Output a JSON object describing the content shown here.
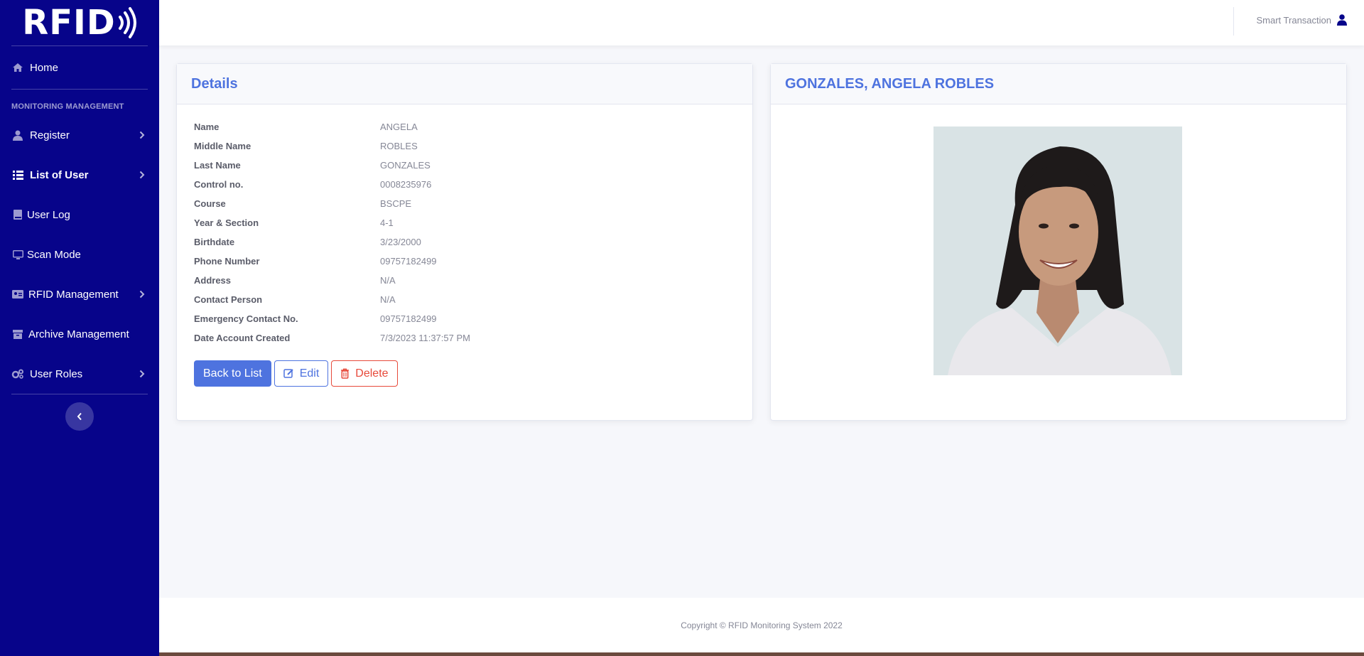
{
  "sidebar": {
    "brand": "RFID",
    "items": [
      {
        "label": "Home"
      },
      {
        "label": "Register"
      },
      {
        "label": "List of User"
      },
      {
        "label": "User Log"
      },
      {
        "label": "Scan Mode"
      },
      {
        "label": "RFID Management"
      },
      {
        "label": "Archive Management"
      },
      {
        "label": "User Roles"
      }
    ],
    "section_heading": "MONITORING MANAGEMENT"
  },
  "topbar": {
    "user_name": "Smart Transaction"
  },
  "details": {
    "title": "Details",
    "fields": [
      {
        "label": "Name",
        "value": "ANGELA"
      },
      {
        "label": "Middle Name",
        "value": "ROBLES"
      },
      {
        "label": "Last Name",
        "value": "GONZALES"
      },
      {
        "label": "Control no.",
        "value": "0008235976"
      },
      {
        "label": "Course",
        "value": "BSCPE"
      },
      {
        "label": "Year & Section",
        "value": "4-1"
      },
      {
        "label": "Birthdate",
        "value": "3/23/2000"
      },
      {
        "label": "Phone Number",
        "value": "09757182499"
      },
      {
        "label": "Address",
        "value": "N/A"
      },
      {
        "label": "Contact Person",
        "value": "N/A"
      },
      {
        "label": "Emergency Contact No.",
        "value": "09757182499"
      },
      {
        "label": "Date Account Created",
        "value": "7/3/2023 11:37:57 PM"
      }
    ],
    "buttons": {
      "back": "Back to List",
      "edit": "Edit",
      "delete": "Delete"
    }
  },
  "profile": {
    "title": "GONZALES, ANGELA ROBLES"
  },
  "footer": {
    "text": "Copyright © RFID Monitoring System 2022"
  },
  "colors": {
    "sidebar_bg": "#07048a",
    "primary": "#4e73df",
    "danger": "#e74a3b"
  }
}
